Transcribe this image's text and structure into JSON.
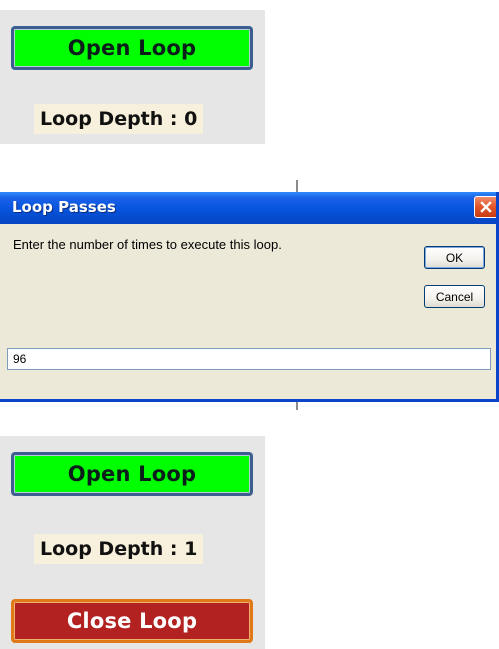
{
  "top_panel": {
    "open_loop_label": "Open Loop",
    "loop_depth_label": "Loop Depth : 0",
    "button_color": "#00ff00"
  },
  "dialog": {
    "title": "Loop Passes",
    "prompt": "Enter the number of times to execute this loop.",
    "ok_label": "OK",
    "cancel_label": "Cancel",
    "input_value": "96",
    "close_icon": "close-icon"
  },
  "bottom_panel": {
    "open_loop_label": "Open Loop",
    "loop_depth_label": "Loop Depth : 1",
    "close_loop_label": "Close Loop",
    "open_color": "#00ff00",
    "close_color": "#b12220"
  }
}
